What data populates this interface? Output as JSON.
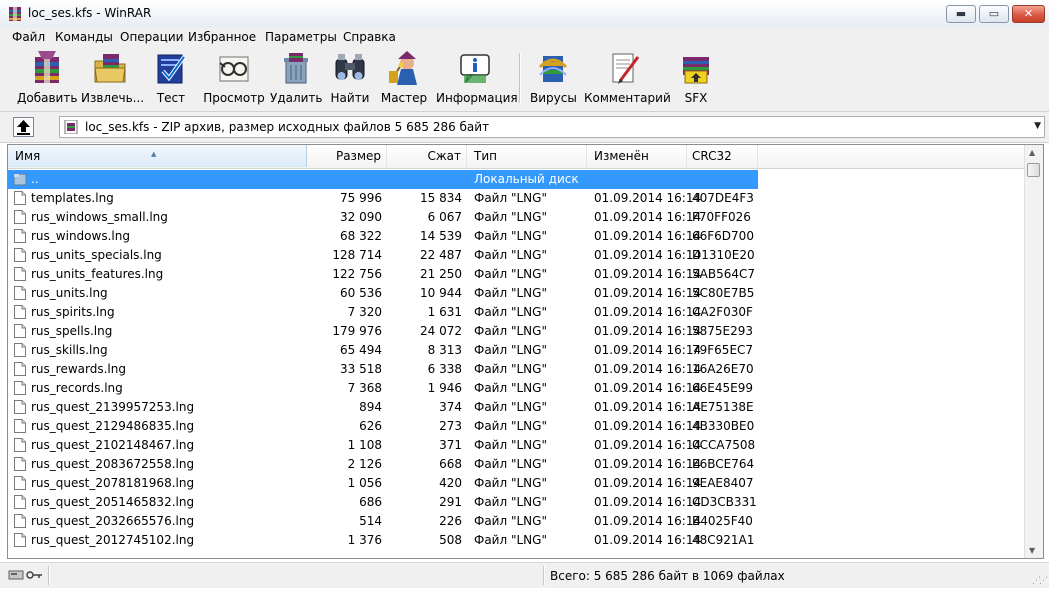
{
  "window": {
    "title": "loc_ses.kfs - WinRAR",
    "minimize": "▬",
    "maximize": "▭",
    "close": "✕"
  },
  "menu": [
    "Файл",
    "Команды",
    "Операции",
    "Избранное",
    "Параметры",
    "Справка"
  ],
  "toolbar": [
    {
      "label": "Добавить",
      "icon": "add-archive-icon"
    },
    {
      "label": "Извлечь...",
      "icon": "extract-icon"
    },
    {
      "label": "Тест",
      "icon": "test-icon"
    },
    {
      "label": "Просмотр",
      "icon": "view-icon"
    },
    {
      "label": "Удалить",
      "icon": "delete-icon"
    },
    {
      "label": "Найти",
      "icon": "find-icon"
    },
    {
      "label": "Мастер",
      "icon": "wizard-icon"
    },
    {
      "label": "Информация",
      "icon": "info-icon"
    },
    {
      "label": "Вирусы",
      "icon": "virus-scan-icon"
    },
    {
      "label": "Комментарий",
      "icon": "comment-icon"
    },
    {
      "label": "SFX",
      "icon": "sfx-icon"
    }
  ],
  "address": {
    "path": "loc_ses.kfs - ZIP архив, размер исходных файлов 5 685 286 байт"
  },
  "columns": [
    "Имя",
    "Размер",
    "Сжат",
    "Тип",
    "Изменён",
    "CRC32"
  ],
  "parent_row": {
    "name": "..",
    "type": "Локальный диск"
  },
  "files": [
    {
      "name": "templates.lng",
      "size": "75 996",
      "packed": "15 834",
      "type": "Файл \"LNG\"",
      "modified": "01.09.2014 16:14",
      "crc": "407DE4F3"
    },
    {
      "name": "rus_windows_small.lng",
      "size": "32 090",
      "packed": "6 067",
      "type": "Файл \"LNG\"",
      "modified": "01.09.2014 16:14",
      "crc": "F70FF026"
    },
    {
      "name": "rus_windows.lng",
      "size": "68 322",
      "packed": "14 539",
      "type": "Файл \"LNG\"",
      "modified": "01.09.2014 16:14",
      "crc": "66F6D700"
    },
    {
      "name": "rus_units_specials.lng",
      "size": "128 714",
      "packed": "22 487",
      "type": "Файл \"LNG\"",
      "modified": "01.09.2014 16:14",
      "crc": "D1310E20"
    },
    {
      "name": "rus_units_features.lng",
      "size": "122 756",
      "packed": "21 250",
      "type": "Файл \"LNG\"",
      "modified": "01.09.2014 16:14",
      "crc": "5AB564C7"
    },
    {
      "name": "rus_units.lng",
      "size": "60 536",
      "packed": "10 944",
      "type": "Файл \"LNG\"",
      "modified": "01.09.2014 16:14",
      "crc": "5C80E7B5"
    },
    {
      "name": "rus_spirits.lng",
      "size": "7 320",
      "packed": "1 631",
      "type": "Файл \"LNG\"",
      "modified": "01.09.2014 16:14",
      "crc": "CA2F030F"
    },
    {
      "name": "rus_spells.lng",
      "size": "179 976",
      "packed": "24 072",
      "type": "Файл \"LNG\"",
      "modified": "01.09.2014 16:14",
      "crc": "5875E293"
    },
    {
      "name": "rus_skills.lng",
      "size": "65 494",
      "packed": "8 313",
      "type": "Файл \"LNG\"",
      "modified": "01.09.2014 16:14",
      "crc": "79F65EC7"
    },
    {
      "name": "rus_rewards.lng",
      "size": "33 518",
      "packed": "6 338",
      "type": "Файл \"LNG\"",
      "modified": "01.09.2014 16:14",
      "crc": "16A26E70"
    },
    {
      "name": "rus_records.lng",
      "size": "7 368",
      "packed": "1 946",
      "type": "Файл \"LNG\"",
      "modified": "01.09.2014 16:14",
      "crc": "66E45E99"
    },
    {
      "name": "rus_quest_2139957253.lng",
      "size": "894",
      "packed": "374",
      "type": "Файл \"LNG\"",
      "modified": "01.09.2014 16:14",
      "crc": "AE75138E"
    },
    {
      "name": "rus_quest_2129486835.lng",
      "size": "626",
      "packed": "273",
      "type": "Файл \"LNG\"",
      "modified": "01.09.2014 16:14",
      "crc": "4B330BE0"
    },
    {
      "name": "rus_quest_2102148467.lng",
      "size": "1 108",
      "packed": "371",
      "type": "Файл \"LNG\"",
      "modified": "01.09.2014 16:14",
      "crc": "0CCA7508"
    },
    {
      "name": "rus_quest_2083672558.lng",
      "size": "2 126",
      "packed": "668",
      "type": "Файл \"LNG\"",
      "modified": "01.09.2014 16:14",
      "crc": "E6BCE764"
    },
    {
      "name": "rus_quest_2078181968.lng",
      "size": "1 056",
      "packed": "420",
      "type": "Файл \"LNG\"",
      "modified": "01.09.2014 16:14",
      "crc": "9EAE8407"
    },
    {
      "name": "rus_quest_2051465832.lng",
      "size": "686",
      "packed": "291",
      "type": "Файл \"LNG\"",
      "modified": "01.09.2014 16:14",
      "crc": "CD3CB331"
    },
    {
      "name": "rus_quest_2032665576.lng",
      "size": "514",
      "packed": "226",
      "type": "Файл \"LNG\"",
      "modified": "01.09.2014 16:14",
      "crc": "B4025F40"
    },
    {
      "name": "rus_quest_2012745102.lng",
      "size": "1 376",
      "packed": "508",
      "type": "Файл \"LNG\"",
      "modified": "01.09.2014 16:14",
      "crc": "48C921A1"
    }
  ],
  "status": {
    "total": "Всего: 5 685 286 байт в 1069 файлах"
  },
  "colors": {
    "selection": "#3399ff",
    "chrome": "#f0f0f0",
    "close_button": "#d95a44"
  }
}
